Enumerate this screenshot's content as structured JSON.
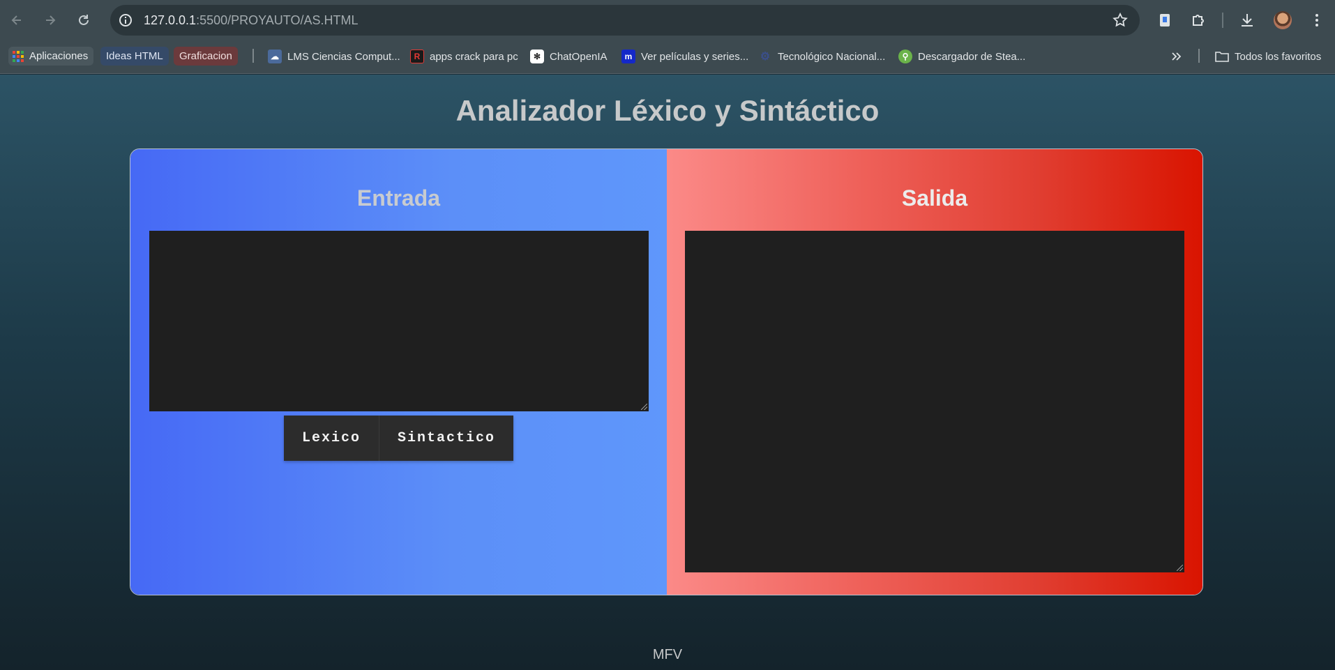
{
  "browser": {
    "url_host": "127.0.0.1",
    "url_rest": ":5500/PROYAUTO/AS.HTML",
    "bookmarks": {
      "apps": "Aplicaciones",
      "ideas": "Ideas HTML",
      "graf": "Graficacion",
      "lms": "LMS Ciencias Comput...",
      "crack": "apps crack para pc",
      "chat": "ChatOpenIA",
      "movies": "Ver películas y series...",
      "tec": "Tecnológico Nacional...",
      "steam": "Descargador de Stea...",
      "all": "Todos los favoritos"
    }
  },
  "page": {
    "title": "Analizador Léxico y Sintáctico",
    "input_heading": "Entrada",
    "output_heading": "Salida",
    "input_value": "",
    "output_value": "",
    "lexico_label": "Lexico",
    "sintactico_label": "Sintactico",
    "footer": "MFV"
  },
  "colors": {
    "left_gradient": [
      "#4669f5",
      "#5f97fb"
    ],
    "right_gradient": [
      "#fb8a88",
      "#d91400"
    ],
    "textarea_bg": "#1f1f1f",
    "button_bg": "#2c2c2c"
  }
}
